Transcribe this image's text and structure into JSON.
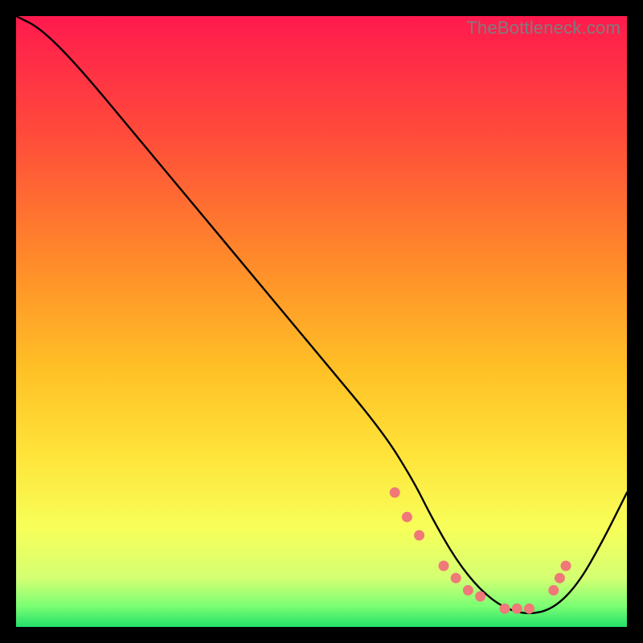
{
  "watermark": "TheBottleneck.com",
  "chart_data": {
    "type": "line",
    "title": "",
    "xlabel": "",
    "ylabel": "",
    "xlim": [
      0,
      100
    ],
    "ylim": [
      0,
      100
    ],
    "curve": {
      "name": "bottleneck-curve",
      "x": [
        0,
        4,
        10,
        20,
        30,
        40,
        50,
        60,
        65,
        68,
        72,
        76,
        80,
        84,
        88,
        92,
        96,
        100
      ],
      "y": [
        100,
        98,
        92,
        80,
        68,
        56,
        44,
        32,
        24,
        18,
        11,
        6,
        3,
        2,
        3,
        7,
        14,
        22
      ]
    },
    "markers": {
      "name": "highlight-points",
      "color": "#f07878",
      "x": [
        62,
        64,
        66,
        70,
        72,
        74,
        76,
        80,
        82,
        84,
        88,
        89,
        90
      ],
      "y": [
        22,
        18,
        15,
        10,
        8,
        6,
        5,
        3,
        3,
        3,
        6,
        8,
        10
      ]
    },
    "gradient_stops": [
      {
        "offset": 0.0,
        "color": "#ff1a4e"
      },
      {
        "offset": 0.2,
        "color": "#ff4d3a"
      },
      {
        "offset": 0.4,
        "color": "#ff8a2a"
      },
      {
        "offset": 0.58,
        "color": "#ffc126"
      },
      {
        "offset": 0.72,
        "color": "#ffe43a"
      },
      {
        "offset": 0.84,
        "color": "#f7ff5a"
      },
      {
        "offset": 0.92,
        "color": "#d4ff72"
      },
      {
        "offset": 0.965,
        "color": "#7dff74"
      },
      {
        "offset": 1.0,
        "color": "#23e06a"
      }
    ]
  }
}
